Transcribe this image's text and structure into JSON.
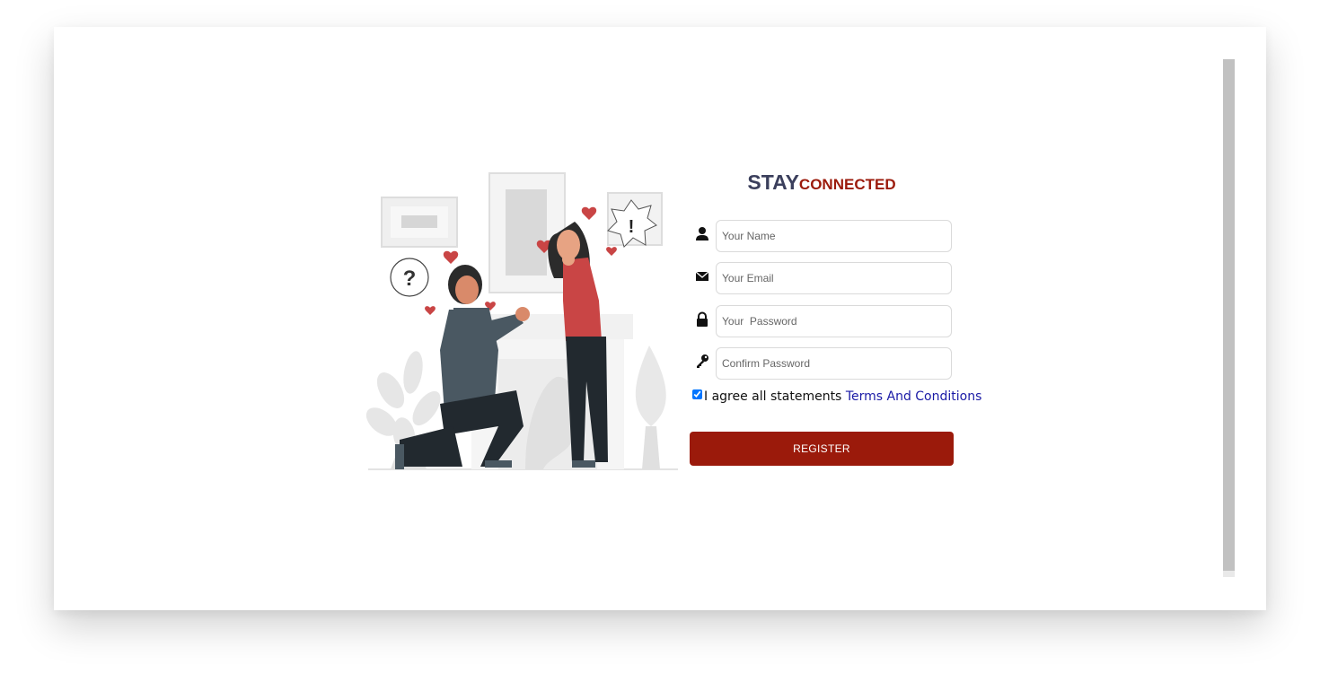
{
  "brand": {
    "part1": "STAY",
    "part2": "CONNECTED"
  },
  "form": {
    "name": {
      "placeholder": "Your Name",
      "icon": "user-icon"
    },
    "email": {
      "placeholder": "Your Email",
      "icon": "envelope-icon"
    },
    "password": {
      "placeholder": "Your  Password",
      "icon": "lock-icon"
    },
    "confirm": {
      "placeholder": "Confirm Password",
      "icon": "key-icon"
    },
    "agree_text": "I agree all statements",
    "terms_link": "Terms And Conditions",
    "agree_checked": true,
    "register_label": "REGISTER"
  },
  "illustration": {
    "icon": "proposal-illustration"
  },
  "colors": {
    "accent": "#9b1a0b",
    "brand_dark": "#3b3f5c",
    "link": "#1a1aa6"
  }
}
